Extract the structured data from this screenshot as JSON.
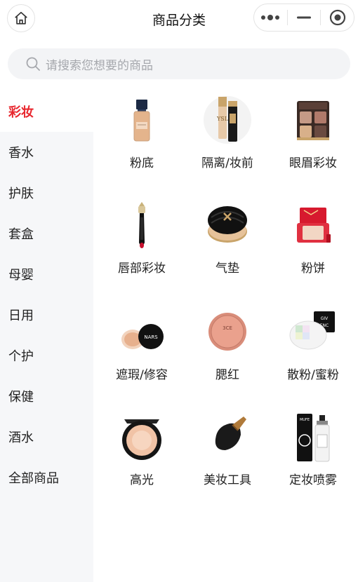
{
  "header": {
    "title": "商品分类"
  },
  "search": {
    "placeholder": "请搜索您想要的商品"
  },
  "sidebar": {
    "items": [
      {
        "label": "彩妆",
        "active": true
      },
      {
        "label": "香水",
        "active": false
      },
      {
        "label": "护肤",
        "active": false
      },
      {
        "label": "套盒",
        "active": false
      },
      {
        "label": "母婴",
        "active": false
      },
      {
        "label": "日用",
        "active": false
      },
      {
        "label": "个护",
        "active": false
      },
      {
        "label": "保健",
        "active": false
      },
      {
        "label": "酒水",
        "active": false
      },
      {
        "label": "全部商品",
        "active": false
      }
    ]
  },
  "categories": [
    {
      "label": "粉底",
      "icon": "foundation-bottle-icon"
    },
    {
      "label": "隔离/妆前",
      "icon": "primer-tube-icon"
    },
    {
      "label": "眼眉彩妆",
      "icon": "eyeshadow-palette-icon"
    },
    {
      "label": "唇部彩妆",
      "icon": "lipstick-icon"
    },
    {
      "label": "气垫",
      "icon": "cushion-compact-icon"
    },
    {
      "label": "粉饼",
      "icon": "pressed-powder-icon"
    },
    {
      "label": "遮瑕/修容",
      "icon": "concealer-jar-icon"
    },
    {
      "label": "腮红",
      "icon": "blush-compact-icon"
    },
    {
      "label": "散粉/蜜粉",
      "icon": "loose-powder-icon"
    },
    {
      "label": "高光",
      "icon": "highlighter-compact-icon"
    },
    {
      "label": "美妆工具",
      "icon": "makeup-brush-icon"
    },
    {
      "label": "定妆喷雾",
      "icon": "setting-spray-icon"
    }
  ],
  "colors": {
    "accent": "#e8262d",
    "sidebar_bg": "#f6f7f9",
    "search_bg": "#f3f4f6"
  }
}
